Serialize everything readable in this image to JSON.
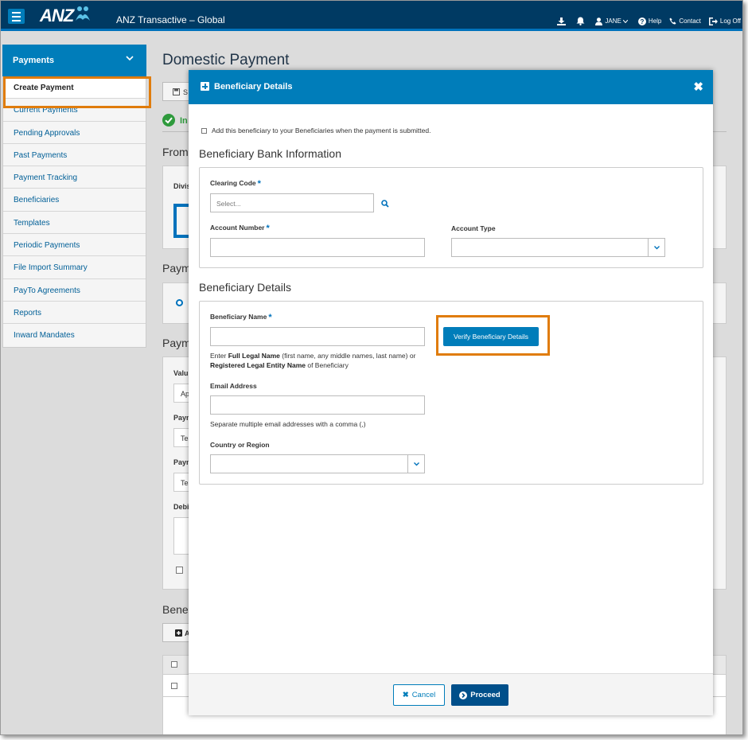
{
  "header": {
    "logo_text": "ANZ",
    "app_title": "ANZ Transactive – Global",
    "user_label": "JANE",
    "help_label": "Help",
    "contact_label": "Contact",
    "logoff_label": "Log Off"
  },
  "sidebar": {
    "title": "Payments",
    "items": [
      {
        "label": "Create Payment"
      },
      {
        "label": "Current Payments"
      },
      {
        "label": "Pending Approvals"
      },
      {
        "label": "Past Payments"
      },
      {
        "label": "Payment Tracking"
      },
      {
        "label": "Beneficiaries"
      },
      {
        "label": "Templates"
      },
      {
        "label": "Periodic Payments"
      },
      {
        "label": "File Import Summary"
      },
      {
        "label": "PayTo Agreements"
      },
      {
        "label": "Reports"
      },
      {
        "label": "Inward Mandates"
      }
    ]
  },
  "page": {
    "title": "Domestic Payment",
    "fragments": [
      "S",
      "In",
      "From",
      "Divis",
      "Paym",
      "Paym",
      "Valu",
      "Ap",
      "Payn",
      "Tes",
      "Paym",
      "Tes",
      "Debi",
      "Bene",
      "A"
    ]
  },
  "modal": {
    "title": "Beneficiary Details",
    "add_checkbox_label": "Add this beneficiary to your Beneficiaries when the payment is submitted.",
    "bank_section_title": "Beneficiary Bank Information",
    "clearing_code_label": "Clearing Code",
    "clearing_code_placeholder": "Select...",
    "account_number_label": "Account Number",
    "account_type_label": "Account Type",
    "details_section_title": "Beneficiary Details",
    "beneficiary_name_label": "Beneficiary Name",
    "verify_button": "Verify Beneficiary Details",
    "name_help": {
      "p1": "Enter ",
      "b1": "Full Legal Name",
      "p2": " (first name, any middle names, last name) or",
      "b2": "Registered Legal Entity Name",
      "p3": " of Beneficiary"
    },
    "email_label": "Email Address",
    "email_help": "Separate multiple email addresses with a comma (,)",
    "country_label": "Country or Region",
    "required_mark": "*",
    "cancel_button": "Cancel",
    "proceed_button": "Proceed"
  }
}
